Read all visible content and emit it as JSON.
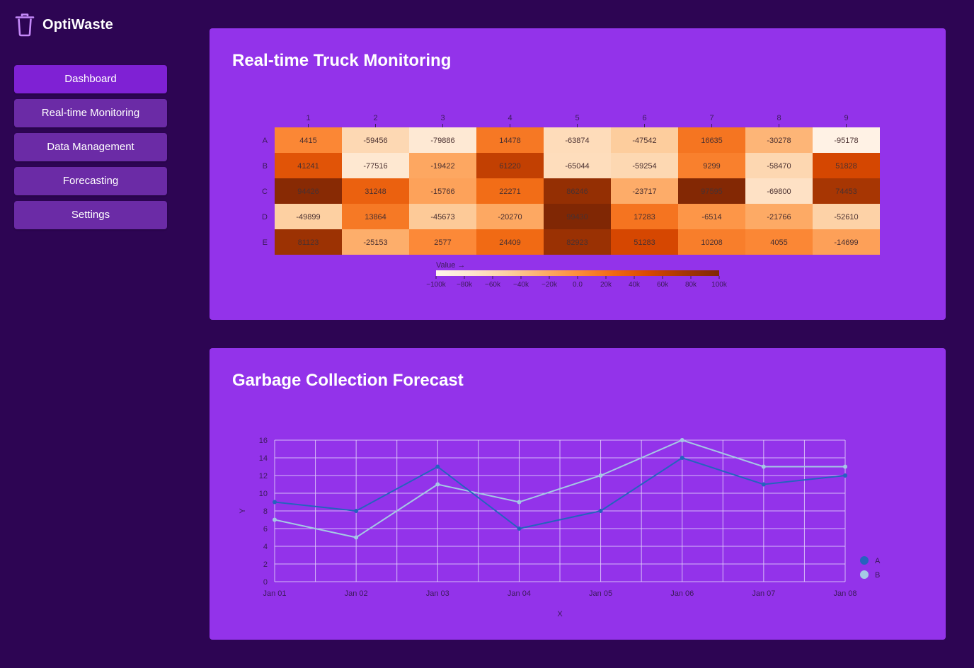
{
  "app": {
    "name": "OptiWaste",
    "logo_icon": "trash-icon"
  },
  "sidebar": {
    "items": [
      {
        "label": "Dashboard",
        "active": true
      },
      {
        "label": "Real-time Monitoring",
        "active": false
      },
      {
        "label": "Data Management",
        "active": false
      },
      {
        "label": "Forecasting",
        "active": false
      },
      {
        "label": "Settings",
        "active": false
      }
    ]
  },
  "colors": {
    "background": "#2d0553",
    "card": "#9333ea",
    "nav_item": "#6b2ba6",
    "nav_item_active": "#7f21d4",
    "series_a": "#2563be",
    "series_b": "#a5c8e4",
    "heat_low": "#fff5eb",
    "heat_high": "#7f2704"
  },
  "heatmap_card": {
    "title": "Real-time Truck Monitoring"
  },
  "forecast_card": {
    "title": "Garbage Collection Forecast"
  },
  "chart_data": [
    {
      "type": "heatmap",
      "title": "",
      "x_labels": [
        "1",
        "2",
        "3",
        "4",
        "5",
        "6",
        "7",
        "8",
        "9"
      ],
      "y_labels": [
        "A",
        "B",
        "C",
        "D",
        "E"
      ],
      "values": [
        [
          4415,
          -59456,
          -79886,
          14478,
          -63874,
          -47542,
          16635,
          -30278,
          -95178
        ],
        [
          41241,
          -77516,
          -19422,
          61220,
          -65044,
          -59254,
          9299,
          -58470,
          51828
        ],
        [
          94426,
          31248,
          -15766,
          22271,
          86246,
          -23717,
          97595,
          -69800,
          74453
        ],
        [
          -49899,
          13864,
          -45673,
          -20270,
          99430,
          17283,
          -6514,
          -21766,
          -52610
        ],
        [
          81123,
          -25153,
          2577,
          24409,
          82923,
          51283,
          10208,
          4055,
          -14699
        ]
      ],
      "color_scale": {
        "label": "Value →",
        "domain": [
          -100000,
          100000
        ],
        "ticks": [
          -100000,
          -80000,
          -60000,
          -40000,
          -20000,
          0,
          20000,
          40000,
          60000,
          80000,
          100000
        ],
        "tick_labels": [
          "−100k",
          "−80k",
          "−60k",
          "−40k",
          "−20k",
          "0.0",
          "20k",
          "40k",
          "60k",
          "80k",
          "100k"
        ],
        "scheme": "oranges",
        "legend_placement": "bottom"
      }
    },
    {
      "type": "line",
      "title": "",
      "x": [
        "Jan 01",
        "Jan 02",
        "Jan 03",
        "Jan 04",
        "Jan 05",
        "Jan 06",
        "Jan 07",
        "Jan 08"
      ],
      "series": [
        {
          "name": "A",
          "values": [
            9,
            8,
            13,
            6,
            8,
            14,
            11,
            12
          ]
        },
        {
          "name": "B",
          "values": [
            7,
            5,
            11,
            9,
            12,
            16,
            13,
            13
          ]
        }
      ],
      "xlabel": "X",
      "ylabel": "Y",
      "ylim": [
        0,
        16
      ],
      "y_ticks": [
        0,
        2,
        4,
        6,
        8,
        10,
        12,
        14,
        16
      ],
      "grid": true,
      "legend_placement": "bottom-right"
    }
  ]
}
